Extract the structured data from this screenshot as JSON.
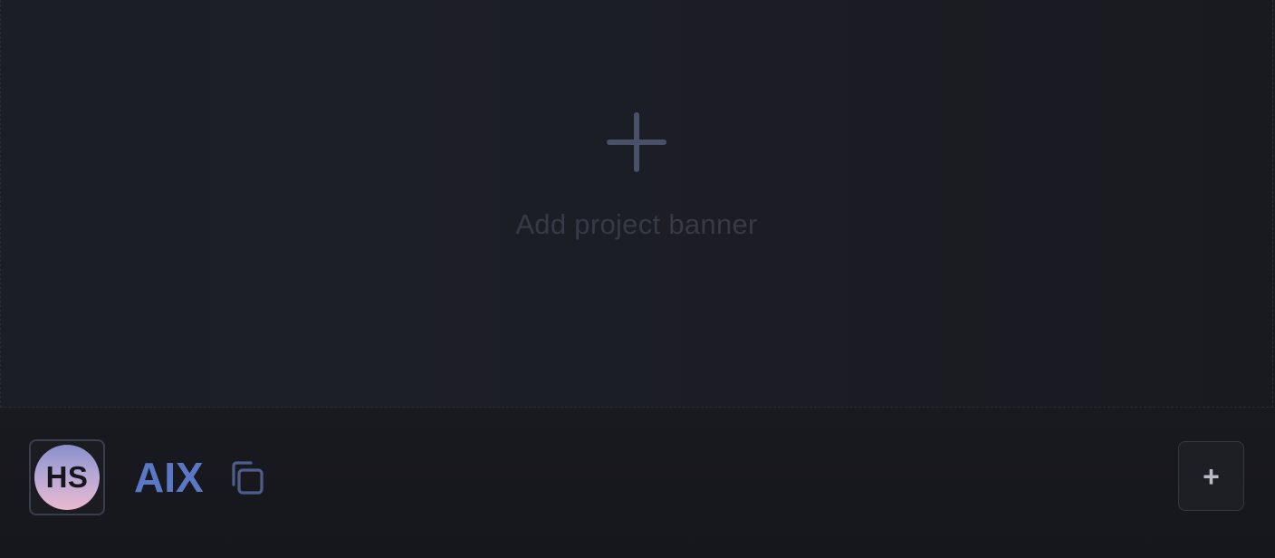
{
  "banner": {
    "label": "Add project banner",
    "icon": "plus-icon"
  },
  "project": {
    "avatar_initials": "HS",
    "name": "AIX",
    "copy_icon": "copy-icon"
  },
  "actions": {
    "add_label": "+",
    "add_icon": "plus-icon"
  },
  "colors": {
    "background": "#17181d",
    "project_name": "#5b78c7",
    "banner_icon": "#4a5068",
    "banner_text": "#363a47"
  }
}
